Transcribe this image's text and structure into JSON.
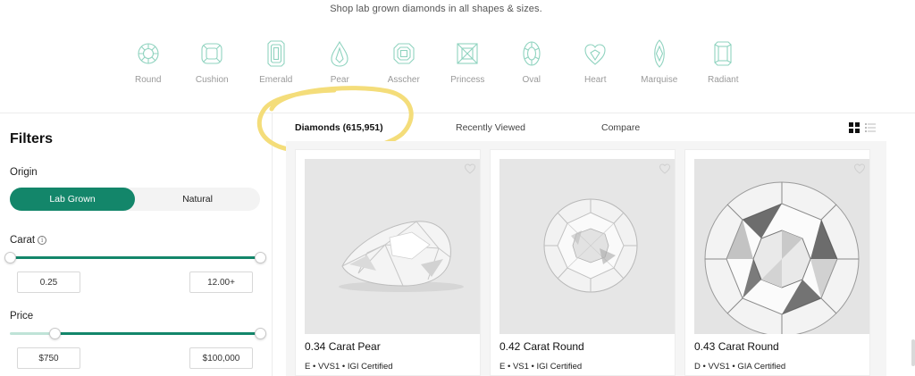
{
  "tagline": "Shop lab grown diamonds in all shapes & sizes.",
  "shapes": [
    {
      "label": "Round",
      "icon": "round-shape-icon"
    },
    {
      "label": "Cushion",
      "icon": "cushion-shape-icon"
    },
    {
      "label": "Emerald",
      "icon": "emerald-shape-icon"
    },
    {
      "label": "Pear",
      "icon": "pear-shape-icon"
    },
    {
      "label": "Asscher",
      "icon": "asscher-shape-icon"
    },
    {
      "label": "Princess",
      "icon": "princess-shape-icon"
    },
    {
      "label": "Oval",
      "icon": "oval-shape-icon"
    },
    {
      "label": "Heart",
      "icon": "heart-shape-icon"
    },
    {
      "label": "Marquise",
      "icon": "marquise-shape-icon"
    },
    {
      "label": "Radiant",
      "icon": "radiant-shape-icon"
    }
  ],
  "filters": {
    "title": "Filters",
    "origin": {
      "label": "Origin",
      "options": [
        "Lab Grown",
        "Natural"
      ],
      "selected": "Lab Grown"
    },
    "carat": {
      "label": "Carat",
      "min": "0.25",
      "max": "12.00+",
      "range_fraction": [
        0.0,
        1.0
      ]
    },
    "price": {
      "label": "Price",
      "min": "$750",
      "max": "$100,000",
      "range_fraction": [
        0.18,
        1.0
      ]
    }
  },
  "tabs": [
    {
      "label": "Diamonds (615,951)",
      "active": true
    },
    {
      "label": "Recently Viewed",
      "active": false
    },
    {
      "label": "Compare",
      "active": false
    }
  ],
  "view_modes": [
    "grid-view-icon",
    "list-view-icon"
  ],
  "products": [
    {
      "title": "0.34 Carat Pear",
      "specs": "E • VVS1 • IGI Certified",
      "image": "pear-diamond"
    },
    {
      "title": "0.42 Carat Round",
      "specs": "E • VS1 • IGI Certified",
      "image": "round-diamond"
    },
    {
      "title": "0.43 Carat Round",
      "specs": "D • VVS1 • GIA Certified",
      "image": "round-diamond-closeup"
    }
  ],
  "colors": {
    "accent": "#13866a",
    "shape_icon": "#8fd3bf",
    "highlight": "#f4dd7a"
  }
}
